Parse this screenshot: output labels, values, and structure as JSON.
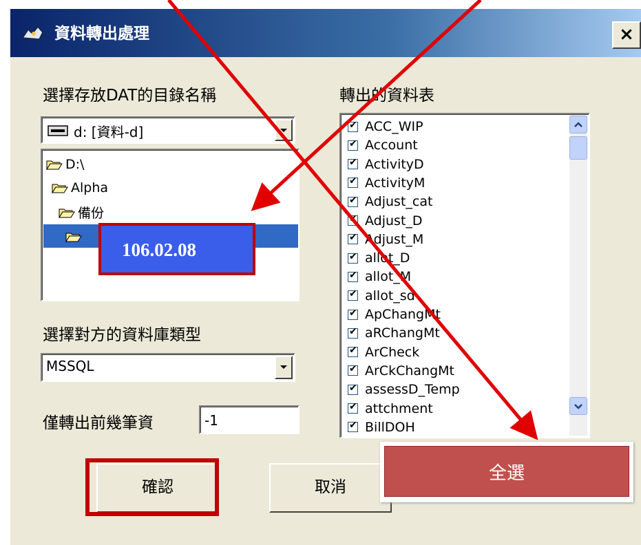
{
  "window": {
    "title": "資料轉出處理",
    "close_label": "×"
  },
  "left": {
    "dir_label": "選擇存放DAT的目錄名稱",
    "drive_value": "d: [資料-d]",
    "tree": [
      "D:\\",
      "Alpha",
      "備份",
      "106.02.08"
    ],
    "db_type_label": "選擇對方的資料庫類型",
    "db_type_value": "MSSQL",
    "rows_label": "僅轉出前幾筆資",
    "rows_value": "-1"
  },
  "right": {
    "tables_label": "轉出的資料表",
    "tables": [
      "ACC_WIP",
      "Account",
      "ActivityD",
      "ActivityM",
      "Adjust_cat",
      "Adjust_D",
      "Adjust_M",
      "allot_D",
      "allot_M",
      "allot_sd",
      "ApChangMt",
      "aRChangMt",
      "ArCheck",
      "ArCkChangMt",
      "assessD_Temp",
      "attchment",
      "BillDOH"
    ]
  },
  "buttons": {
    "ok": "確認",
    "cancel": "取消",
    "select_all": "全選"
  },
  "colors": {
    "annotation_red": "#e00000",
    "highlight_blue": "#3a5eea",
    "select_all_bg": "#c0504d"
  }
}
